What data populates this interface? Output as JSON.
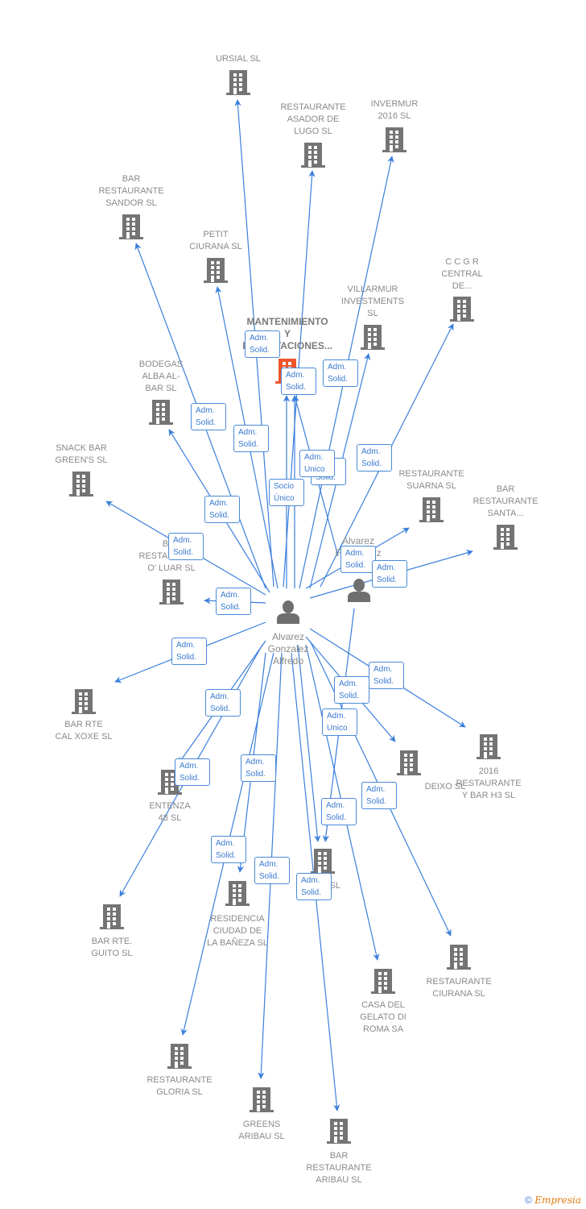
{
  "colors": {
    "edge": "#3b7fdc",
    "building": "#747474",
    "building_main": "#f0542c",
    "person": "#6f6f6f",
    "text": "#8a8a8a"
  },
  "persons": [
    {
      "id": "p1",
      "name": "Alvarez\nGonzalez\nAlfredo"
    },
    {
      "id": "p2",
      "name": "Alvarez\nFernandez"
    }
  ],
  "companies": [
    {
      "id": "ursial",
      "name": "URSIAL SL"
    },
    {
      "id": "asador",
      "name": "RESTAURANTE\nASADOR DE\nLUGO SL"
    },
    {
      "id": "invermur",
      "name": "INVERMUR\n2016  SL"
    },
    {
      "id": "sandor",
      "name": "BAR\nRESTAURANTE\nSANDOR  SL"
    },
    {
      "id": "petit",
      "name": "PETIT\nCIURANA  SL"
    },
    {
      "id": "ccgr",
      "name": "C C G R\nCENTRAL\nDE..."
    },
    {
      "id": "villarmur",
      "name": "VILLARMUR\nINVESTMENTS\nSL"
    },
    {
      "id": "mantenimiento",
      "name": "MANTENIMIENTO\nY\nEXPLOTACIONES...",
      "main": true
    },
    {
      "id": "bodegas",
      "name": "BODEGAS\nALBA AL-\nBAR  SL"
    },
    {
      "id": "snack",
      "name": "SNACK BAR\nGREEN'S  SL"
    },
    {
      "id": "suarna",
      "name": "RESTAURANTE\nSUARNA  SL"
    },
    {
      "id": "santa",
      "name": "BAR\nRESTAURANTE\nSANTA..."
    },
    {
      "id": "oluar",
      "name": "BAR\nRESTAURANTE\nO' LUAR  SL"
    },
    {
      "id": "calxoxe",
      "name": "BAR RTE\nCAL XOXE  SL"
    },
    {
      "id": "entenza",
      "name": "ENTENZA\n48  SL"
    },
    {
      "id": "deixo",
      "name": "DEIXO SL"
    },
    {
      "id": "h3",
      "name": "2016\nRESTAURANTE\nY BAR H3  SL"
    },
    {
      "id": "vigo",
      "name": "VIGO  SL"
    },
    {
      "id": "residencia",
      "name": "RESIDENCIA\nCIUDAD DE\nLA BAÑEZA  SL"
    },
    {
      "id": "guito",
      "name": "BAR RTE.\nGUITO  SL"
    },
    {
      "id": "gelato",
      "name": "CASA DEL\nGELATO DI\nROMA SA"
    },
    {
      "id": "ciurana",
      "name": "RESTAURANTE\nCIURANA SL"
    },
    {
      "id": "gloria",
      "name": "RESTAURANTE\nGLORIA SL"
    },
    {
      "id": "greens",
      "name": "GREENS\nARIBAU  SL"
    },
    {
      "id": "aribau",
      "name": "BAR\nRESTAURANTE\nARIBAU SL"
    }
  ],
  "edges": [
    {
      "from": "p1",
      "to": "ursial",
      "label": "Adm.\nSolid."
    },
    {
      "from": "p1",
      "to": "asador",
      "label": "Adm.\nSolid."
    },
    {
      "from": "p1",
      "to": "invermur",
      "label": "Adm.\nSolid."
    },
    {
      "from": "p1",
      "to": "sandor",
      "label": "Adm.\nSolid."
    },
    {
      "from": "p1",
      "to": "petit",
      "label": "Adm.\nSolid."
    },
    {
      "from": "p1",
      "to": "ccgr",
      "label": "Adm.\nSolid."
    },
    {
      "from": "p1",
      "to": "villarmur",
      "label": "Adm.\nSolid."
    },
    {
      "from": "p1",
      "to": "mantenimiento",
      "label": "Socio\nÚnico"
    },
    {
      "from": "p1",
      "to": "mantenimiento",
      "label": "Adm.\nUnico"
    },
    {
      "from": "p2",
      "to": "mantenimiento",
      "label": "Adm.\nSolid."
    },
    {
      "from": "p1",
      "to": "bodegas",
      "label": "Adm.\nSolid."
    },
    {
      "from": "p1",
      "to": "snack",
      "label": "Adm.\nSolid."
    },
    {
      "from": "p1",
      "to": "suarna",
      "label": "Adm.\nSolid."
    },
    {
      "from": "p1",
      "to": "santa",
      "label": "Adm.\nSolid."
    },
    {
      "from": "p1",
      "to": "oluar",
      "label": "Adm.\nSolid."
    },
    {
      "from": "p1",
      "to": "calxoxe",
      "label": "Adm.\nSolid."
    },
    {
      "from": "p1",
      "to": "entenza",
      "label": "Adm.\nSolid."
    },
    {
      "from": "p1",
      "to": "deixo",
      "label": "Adm.\nSolid."
    },
    {
      "from": "p1",
      "to": "h3",
      "label": "Adm.\nSolid."
    },
    {
      "from": "p2",
      "to": "vigo",
      "label": "Adm.\nUnico"
    },
    {
      "from": "p1",
      "to": "vigo",
      "label": "Adm.\nSolid."
    },
    {
      "from": "p1",
      "to": "residencia",
      "label": "Adm.\nSolid."
    },
    {
      "from": "p1",
      "to": "guito",
      "label": "Adm.\nSolid."
    },
    {
      "from": "p1",
      "to": "gelato",
      "label": "Adm.\nSolid."
    },
    {
      "from": "p1",
      "to": "ciurana",
      "label": "Adm.\nSolid."
    },
    {
      "from": "p1",
      "to": "gloria",
      "label": "Adm.\nSolid."
    },
    {
      "from": "p1",
      "to": "greens",
      "label": "Adm.\nSolid."
    },
    {
      "from": "p1",
      "to": "aribau",
      "label": "Adm.\nSolid."
    }
  ],
  "footer": {
    "copyright": "©",
    "brand": "Empresia"
  }
}
